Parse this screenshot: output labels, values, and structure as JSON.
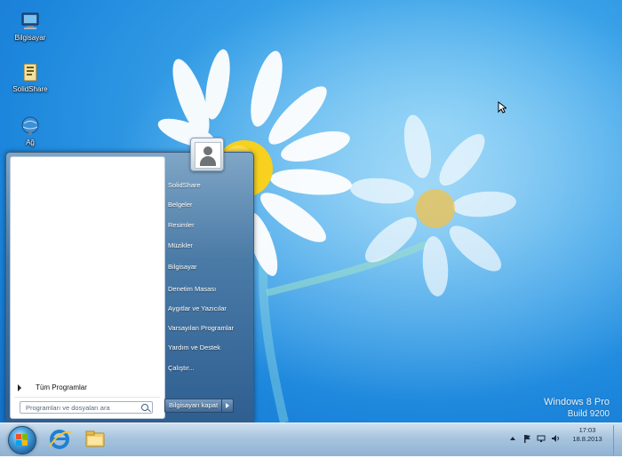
{
  "desktop_icons": [
    {
      "label": "Bilgisayar",
      "icon": "computer-icon"
    },
    {
      "label": "SolidShare",
      "icon": "folder-document-icon"
    },
    {
      "label": "Ağ",
      "icon": "network-icon"
    }
  ],
  "watermark": {
    "line1": "Windows 8 Pro",
    "line2": "Build 9200"
  },
  "start_menu": {
    "all_programs": "Tüm Programlar",
    "search_placeholder": "Programları ve dosyaları ara",
    "right_items": [
      "SolidShare",
      "Belgeler",
      "Resimler",
      "Müzikler",
      "Bilgisayar",
      "Denetim Masası",
      "Aygıtlar ve Yazıcılar",
      "Varsayılan Programlar",
      "Yardım ve Destek",
      "Çalıştır..."
    ],
    "shutdown_label": "Bilgisayarı kapat"
  },
  "taskbar": {
    "pinned": [
      "internet-explorer-icon",
      "file-explorer-icon"
    ],
    "time": "17:03",
    "date": "18.8.2013"
  }
}
